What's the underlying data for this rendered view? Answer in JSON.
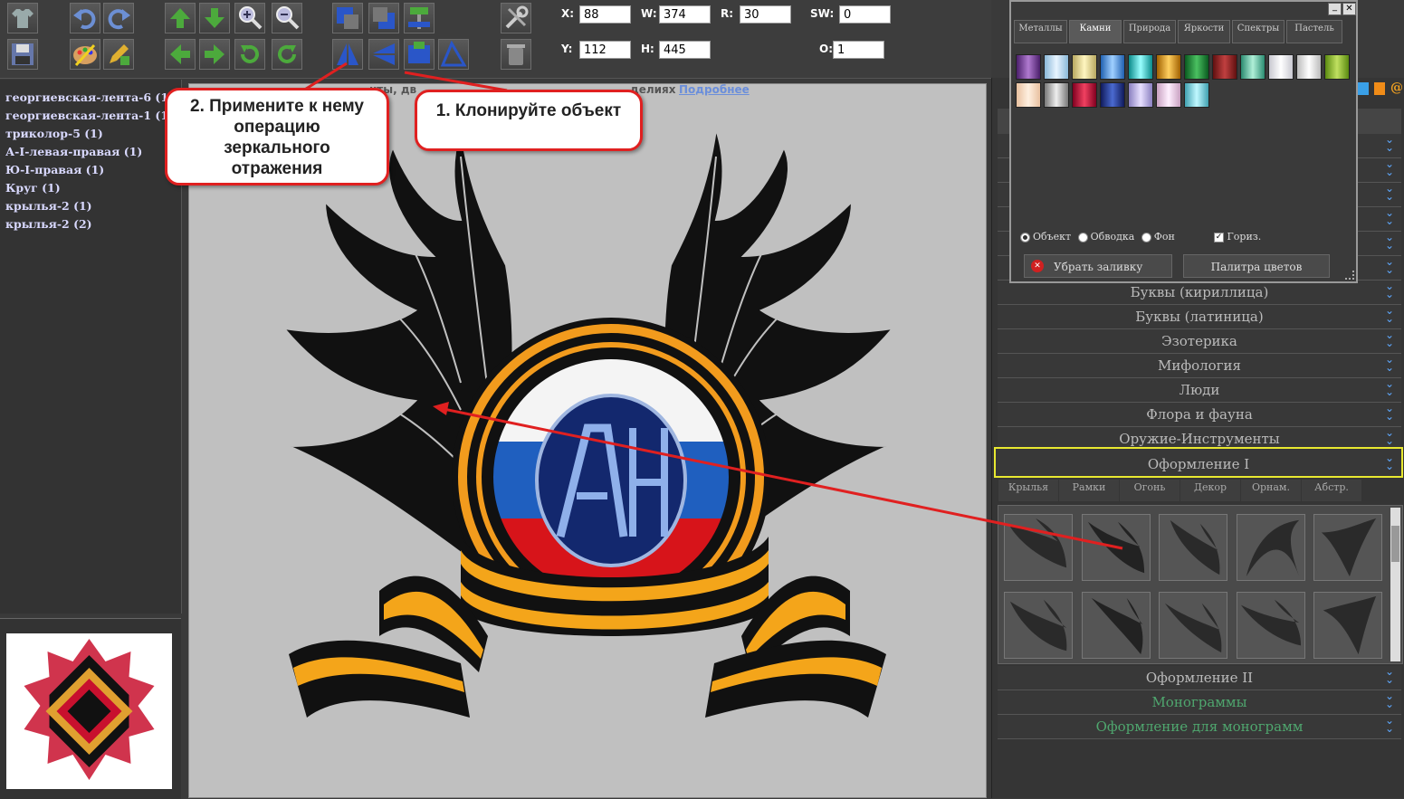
{
  "coords": {
    "x_label": "X:",
    "x_value": "88",
    "y_label": "Y:",
    "y_value": "112",
    "w_label": "W:",
    "w_value": "374",
    "h_label": "H:",
    "h_value": "445",
    "r_label": "R:",
    "r_value": "30",
    "sw_label": "SW:",
    "sw_value": "0",
    "o_label": "O:",
    "o_value": "1"
  },
  "layers": [
    "георгиевская-лента-6 (1)",
    "георгиевская-лента-1 (1)",
    "триколор-5 (1)",
    "А-I-левая-правая (1)",
    "Ю-I-правая (1)",
    "Круг (1)",
    "крылья-2 (1)",
    "крылья-2 (2)"
  ],
  "hint": {
    "text": "нты, дв",
    "text2": "делиях",
    "link": "Подробнее"
  },
  "callouts": {
    "one": "1. Клонируйте объект",
    "two": "2. Примените к нему операцию зеркального отражения"
  },
  "color_window": {
    "tabs": [
      "Металлы",
      "Камни",
      "Природа",
      "Яркости",
      "Спектры",
      "Пастель"
    ],
    "active_tab": "Камни",
    "radios": {
      "object": "Объект",
      "stroke": "Обводка",
      "background": "Фон"
    },
    "checkbox": "Гориз.",
    "remove_fill": "Убрать заливку",
    "palette": "Палитра цветов"
  },
  "categories": [
    "Буквы (кириллица)",
    "Буквы (латиница)",
    "Эзотерика",
    "Мифология",
    "Люди",
    "Флора и фауна",
    "Оружие-Инструменты",
    "Оформление I"
  ],
  "categories_after": [
    "Оформление II",
    "Монограммы",
    "Оформление для монограмм"
  ],
  "subtabs": [
    "Крылья",
    "Рамки",
    "Огонь",
    "Декор",
    "Орнам.",
    "Абстр."
  ],
  "colors": {
    "accent_blue": "#5fa9ff",
    "highlight": "#e8e830",
    "callout_border": "#e02020",
    "layer_text": "#d9d9ff"
  },
  "icons": {
    "toolbar_row1": [
      "tshirt-icon",
      "undo-icon",
      "redo-icon",
      "move-up-icon",
      "move-down-icon",
      "zoom-in-icon",
      "zoom-out-icon",
      "bring-front-icon",
      "send-back-icon",
      "align-icon",
      "tools-icon"
    ],
    "toolbar_row2": [
      "save-icon",
      "palette-icon",
      "edit-icon",
      "move-left-icon",
      "move-right-icon",
      "rotate-ccw-icon",
      "rotate-cw-icon",
      "flip-horizontal-icon",
      "flip-vertical-icon",
      "clone-icon",
      "skew-icon",
      "trash-icon"
    ]
  }
}
